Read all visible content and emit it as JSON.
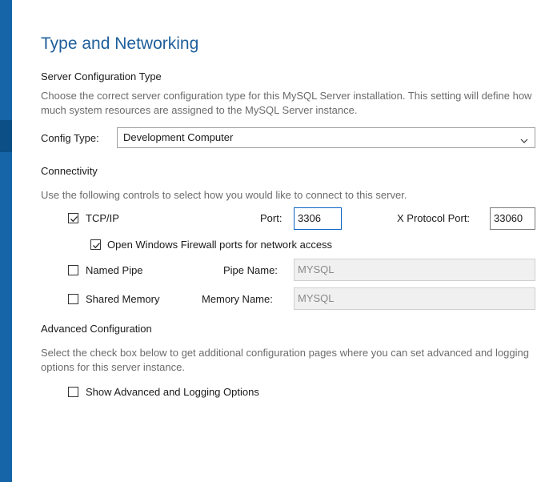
{
  "page": {
    "title": "Type and Networking"
  },
  "server_config": {
    "heading": "Server Configuration Type",
    "description": "Choose the correct server configuration type for this MySQL Server installation. This setting will define how much system resources are assigned to the MySQL Server instance.",
    "config_type_label": "Config Type:",
    "config_type_value": "Development Computer",
    "config_type_icon": "chevron-down-icon"
  },
  "connectivity": {
    "heading": "Connectivity",
    "description": "Use the following controls to select how you would like to connect to this server.",
    "tcpip": {
      "label": "TCP/IP",
      "checked": true
    },
    "port": {
      "label": "Port:",
      "value": "3306"
    },
    "x_protocol_port": {
      "label": "X Protocol Port:",
      "value": "33060"
    },
    "firewall": {
      "label": "Open Windows Firewall ports for network access",
      "checked": true
    },
    "named_pipe": {
      "label": "Named Pipe",
      "checked": false
    },
    "pipe_name": {
      "label": "Pipe Name:",
      "value": "MYSQL"
    },
    "shared_memory": {
      "label": "Shared Memory",
      "checked": false
    },
    "memory_name": {
      "label": "Memory Name:",
      "value": "MYSQL"
    }
  },
  "advanced": {
    "heading": "Advanced Configuration",
    "description": "Select the check box below to get additional configuration pages where you can set advanced and logging options for this server instance.",
    "show_advanced": {
      "label": "Show Advanced and Logging Options",
      "checked": false
    }
  },
  "colors": {
    "accent": "#1565a8",
    "title": "#1f5f9c",
    "focus_border": "#0a64c8"
  }
}
